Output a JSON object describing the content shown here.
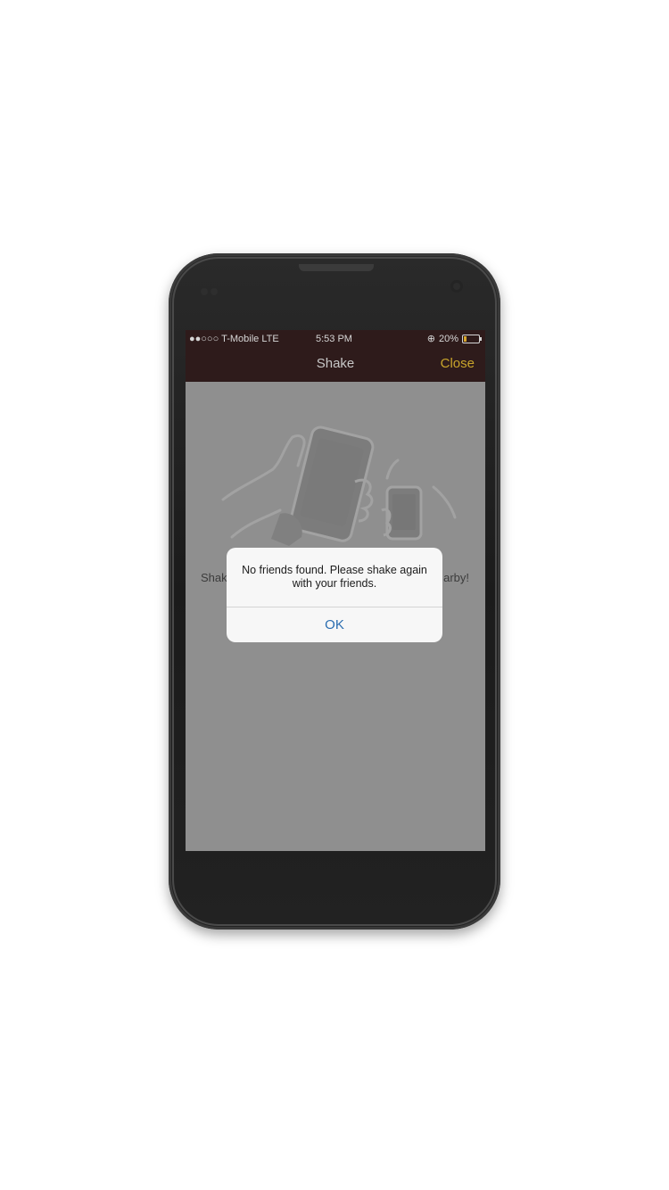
{
  "status_bar": {
    "carrier": "●●○○○ T-Mobile  LTE",
    "time": "5:53 PM",
    "battery_text": "20%",
    "battery_level": 0.2
  },
  "nav": {
    "title": "Shake",
    "close_label": "Close"
  },
  "background": {
    "text_left": "Shak",
    "text_right": "arby!"
  },
  "alert": {
    "message": "No friends found. Please shake again with your friends.",
    "ok_label": "OK"
  },
  "colors": {
    "nav_background": "#2e1b1b",
    "close_accent": "#c9a52b",
    "ok_accent": "#2a6db0"
  }
}
